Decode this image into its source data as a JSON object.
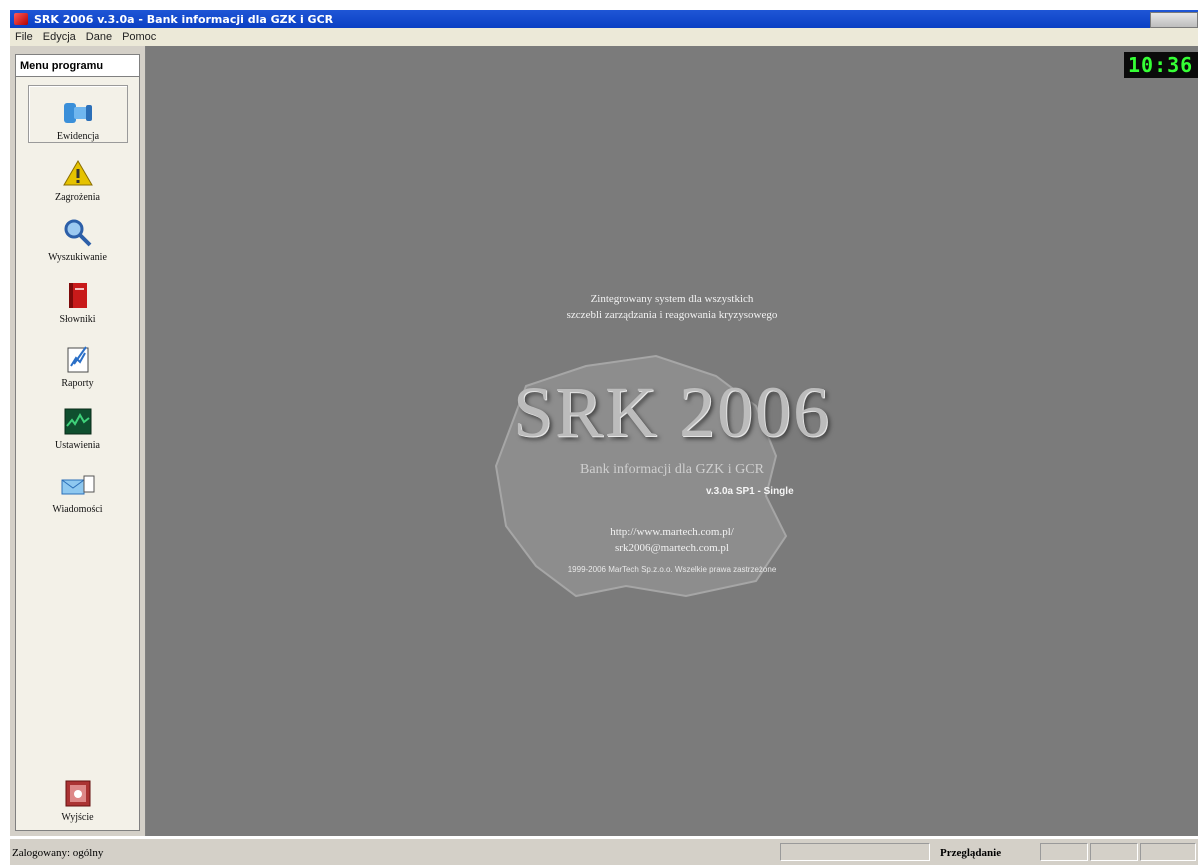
{
  "window": {
    "title": "SRK 2006 v.3.0a - Bank informacji dla GZK i GCR"
  },
  "menu": [
    "File",
    "Edycja",
    "Dane",
    "Pomoc"
  ],
  "sidebar": {
    "header": "Menu programu",
    "items": [
      {
        "label": "Ewidencja",
        "icon": "database-icon"
      },
      {
        "label": "Zagrożenia",
        "icon": "warning-icon"
      },
      {
        "label": "Wyszukiwanie",
        "icon": "search-icon"
      },
      {
        "label": "Słowniki",
        "icon": "books-icon"
      },
      {
        "label": "Raporty",
        "icon": "report-icon"
      },
      {
        "label": "Ustawienia",
        "icon": "settings-icon"
      },
      {
        "label": "Wiadomości",
        "icon": "messages-icon"
      }
    ],
    "exit": {
      "label": "Wyjście",
      "icon": "exit-icon"
    }
  },
  "clock": "10:36",
  "splash": {
    "tagline_1": "Zintegrowany system dla wszystkich",
    "tagline_2": "szczebli zarządzania i reagowania kryzysowego",
    "title": "SRK 2006",
    "subtitle": "Bank informacji dla GZK i GCR",
    "version": "v.3.0a SP1 - Single",
    "url": "http://www.martech.com.pl/",
    "email": "srk2006@martech.com.pl",
    "copyright": "1999-2006 MarTech Sp.z.o.o. Wszelkie prawa zastrzeżone"
  },
  "status": {
    "user": "Zalogowany: ogólny",
    "mode": "Przeglądanie"
  },
  "colors": {
    "titlebar": "#0a3fc4",
    "workspace": "#7b7b7b",
    "clock_text": "#35ff35"
  }
}
